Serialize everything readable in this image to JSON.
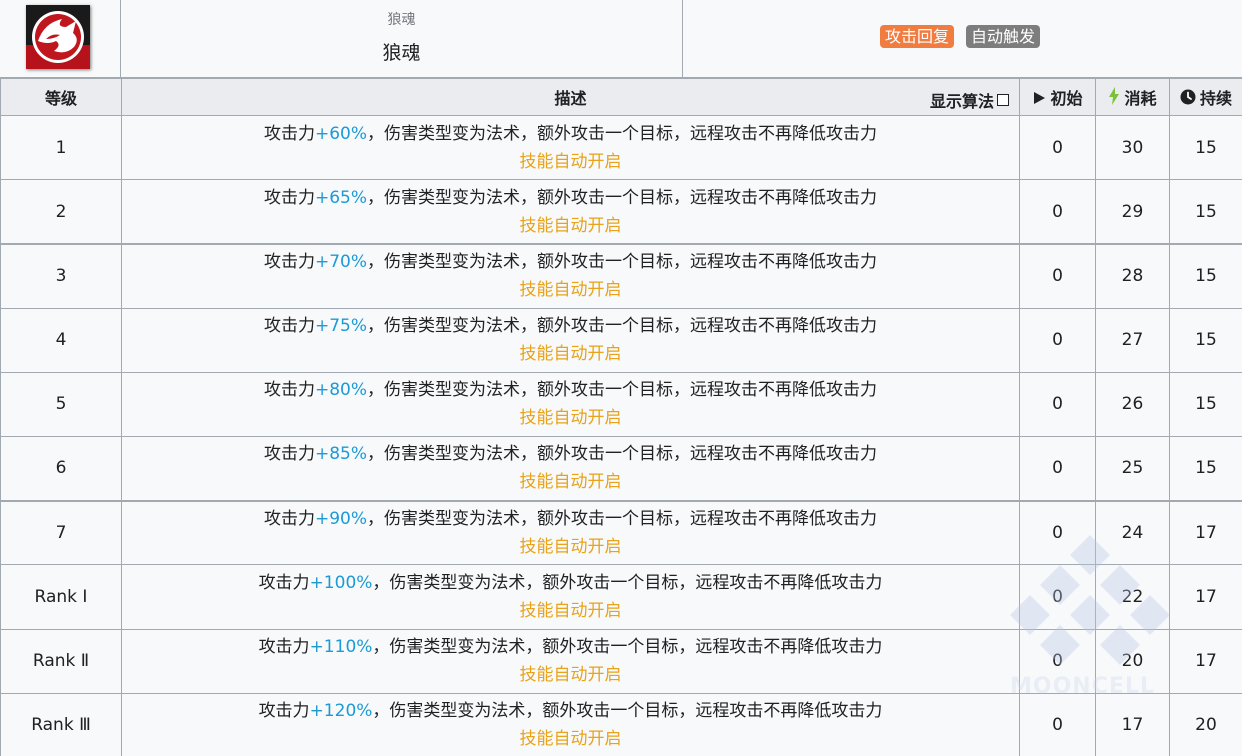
{
  "skill": {
    "name_small": "狼魂",
    "name": "狼魂",
    "tags": [
      {
        "label": "攻击回复",
        "color": "#f07c40"
      },
      {
        "label": "自动触发",
        "color": "#7d7d7d"
      }
    ]
  },
  "table": {
    "headers": {
      "level": "等级",
      "desc": "描述",
      "show_algo": "显示算法",
      "initial": "初始",
      "cost": "消耗",
      "duration": "持续"
    },
    "desc_prefix": "攻击力",
    "desc_suffix": "，伤害类型变为法术，额外攻击一个目标，远程攻击不再降低攻击力",
    "auto_text": "技能自动开启",
    "rows": [
      {
        "level": "1",
        "bonus": "+60%",
        "initial": "0",
        "cost": "30",
        "duration": "15"
      },
      {
        "level": "2",
        "bonus": "+65%",
        "initial": "0",
        "cost": "29",
        "duration": "15"
      },
      {
        "level": "3",
        "bonus": "+70%",
        "initial": "0",
        "cost": "28",
        "duration": "15"
      },
      {
        "level": "4",
        "bonus": "+75%",
        "initial": "0",
        "cost": "27",
        "duration": "15"
      },
      {
        "level": "5",
        "bonus": "+80%",
        "initial": "0",
        "cost": "26",
        "duration": "15"
      },
      {
        "level": "6",
        "bonus": "+85%",
        "initial": "0",
        "cost": "25",
        "duration": "15"
      },
      {
        "level": "7",
        "bonus": "+90%",
        "initial": "0",
        "cost": "24",
        "duration": "17"
      },
      {
        "level": "Rank Ⅰ",
        "bonus": "+100%",
        "initial": "0",
        "cost": "22",
        "duration": "17"
      },
      {
        "level": "Rank Ⅱ",
        "bonus": "+110%",
        "initial": "0",
        "cost": "20",
        "duration": "17"
      },
      {
        "level": "Rank Ⅲ",
        "bonus": "+120%",
        "initial": "0",
        "cost": "17",
        "duration": "20"
      }
    ]
  },
  "watermark": "MOONCELL",
  "colors": {
    "highlight": "#1c9ad6",
    "auto": "#e8a31a",
    "cost_icon": "#7bc13a",
    "border": "#a2a9b1"
  }
}
